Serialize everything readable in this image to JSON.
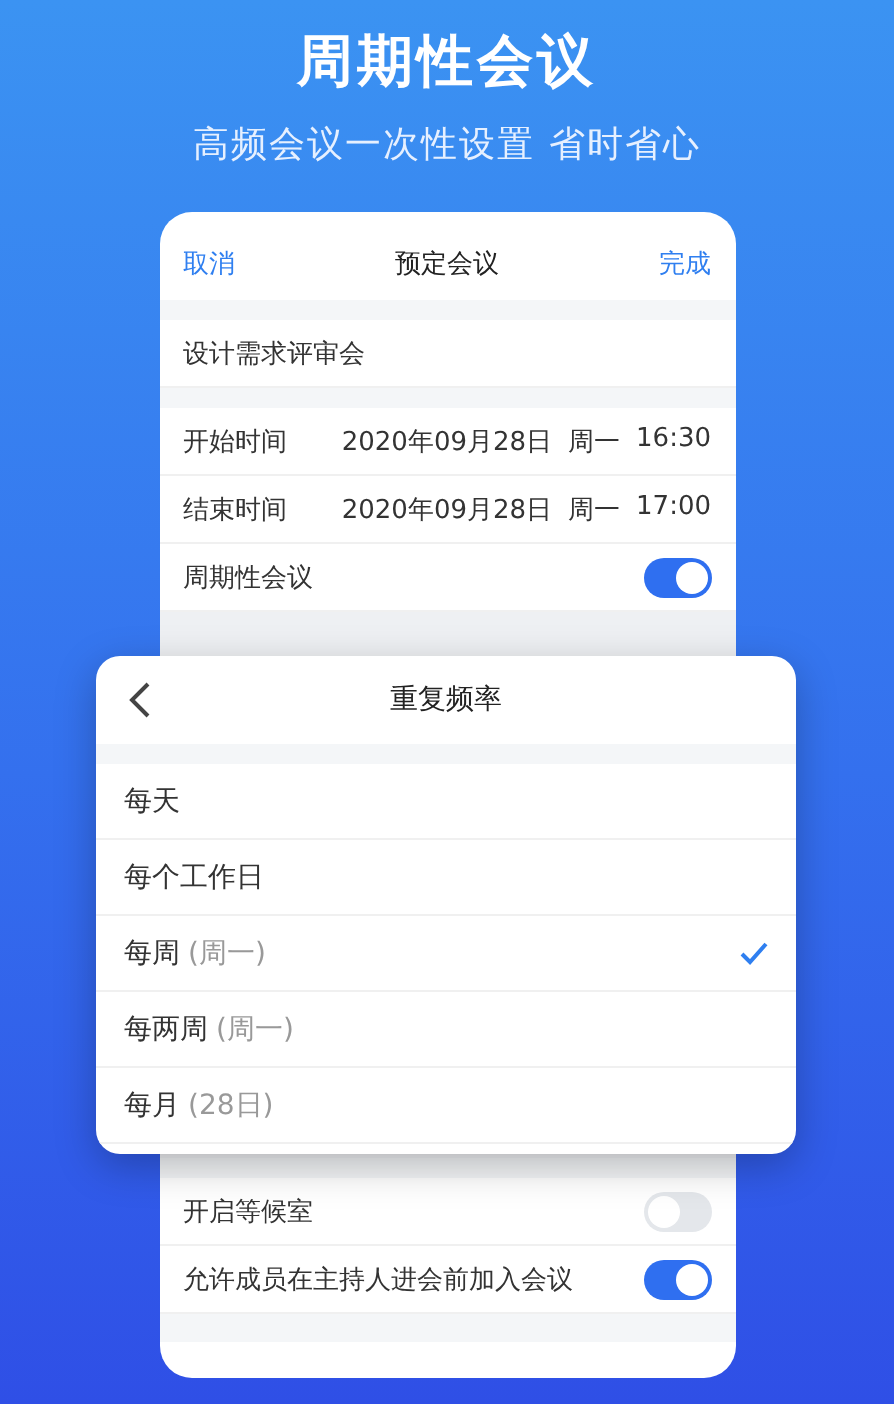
{
  "hero": {
    "title": "周期性会议",
    "subtitle": "高频会议一次性设置 省时省心"
  },
  "nav": {
    "cancel": "取消",
    "title": "预定会议",
    "done": "完成"
  },
  "meeting_name": "设计需求评审会",
  "time_rows": [
    {
      "label": "开始时间",
      "date": "2020年09月28日",
      "weekday": "周一",
      "time": "16:30"
    },
    {
      "label": "结束时间",
      "date": "2020年09月28日",
      "weekday": "周一",
      "time": "17:00"
    }
  ],
  "recurring": {
    "label": "周期性会议",
    "on": true
  },
  "settings": [
    {
      "label": "开启等候室",
      "on": false
    },
    {
      "label": "允许成员在主持人进会前加入会议",
      "on": true
    }
  ],
  "repeat_dialog": {
    "title": "重复频率",
    "options": [
      {
        "label": "每天",
        "selected": false
      },
      {
        "label": "每个工作日",
        "selected": false
      },
      {
        "label": "每周",
        "detail": "(周一)",
        "selected": true
      },
      {
        "label": "每两周",
        "detail": "(周一)",
        "selected": false
      },
      {
        "label": "每月",
        "detail": "(28日)",
        "selected": false
      }
    ]
  }
}
